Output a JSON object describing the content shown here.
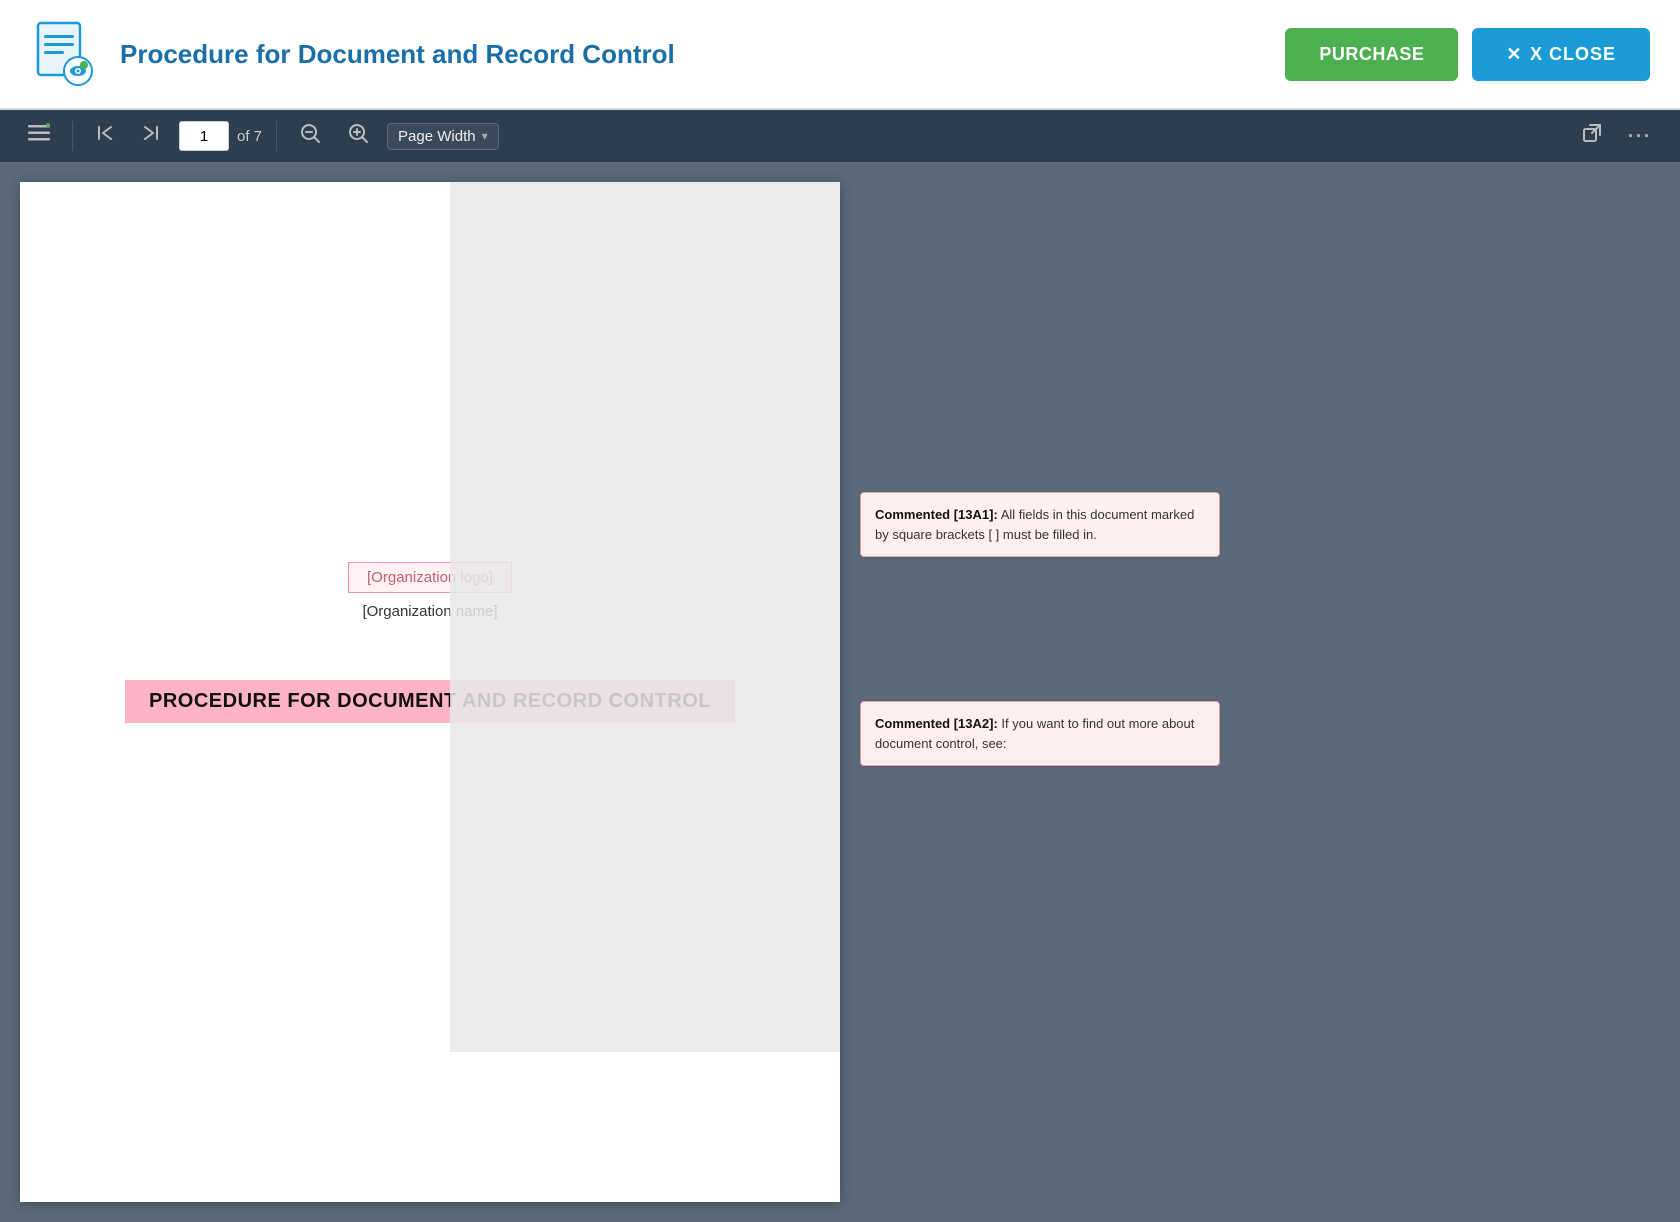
{
  "header": {
    "title": "Procedure for Document and Record Control",
    "purchase_label": "PURCHASE",
    "close_label": "X CLOSE",
    "close_x": "✕"
  },
  "toolbar": {
    "page_current": "1",
    "page_total": "of 7",
    "zoom_label": "Page Width",
    "sidebar_icon": "☰",
    "first_page_icon": "⇤",
    "last_page_icon": "⇥",
    "zoom_out_icon": "🔍-",
    "zoom_in_icon": "🔍+",
    "open_new_icon": "⧉",
    "more_icon": "•••"
  },
  "document": {
    "org_logo": "[Organization logo]",
    "org_name": "[Organization name]",
    "title": "PROCEDURE FOR DOCUMENT AND RECORD CONTROL"
  },
  "comments": [
    {
      "id": "comment-1",
      "label": "Commented [13A1]:",
      "text": "All fields in this document marked by square brackets [ ] must be filled in."
    },
    {
      "id": "comment-2",
      "label": "Commented [13A2]:",
      "text": "If you want to find out more about document control, see:"
    }
  ]
}
